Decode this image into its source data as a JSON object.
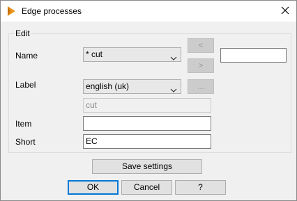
{
  "window": {
    "title": "Edge processes",
    "app_icon": "app-logo-icon",
    "close_icon": "close-icon"
  },
  "group": {
    "legend": "Edit",
    "name_label": "Name",
    "name_value": "*  cut",
    "prev_button": "<",
    "next_button": ">",
    "label_label": "Label",
    "language_value": "english (uk)",
    "ellipsis_button": "...",
    "label_value": "cut",
    "item_label": "Item",
    "item_value": "",
    "short_label": "Short",
    "short_value": "EC",
    "side_input_value": ""
  },
  "buttons": {
    "save_settings": "Save settings",
    "ok": "OK",
    "cancel": "Cancel",
    "help": "?"
  },
  "colors": {
    "accent": "#0078d7",
    "icon_orange": "#e8951c"
  }
}
